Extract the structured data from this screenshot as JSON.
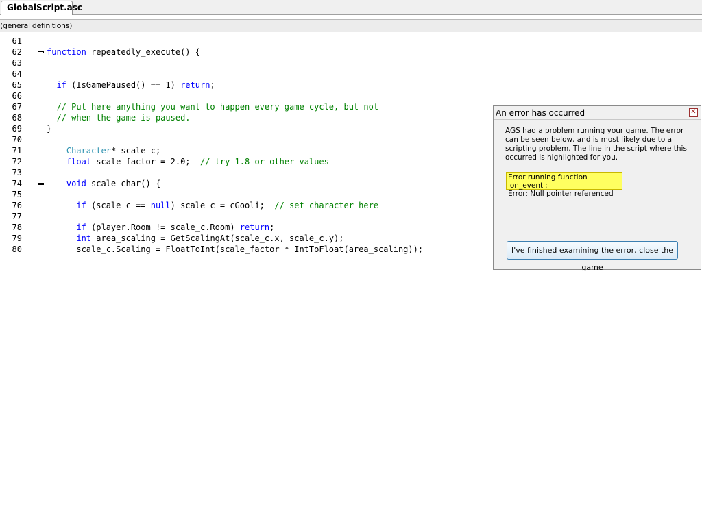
{
  "tab": {
    "label": "GlobalScript.asc"
  },
  "function_selector": {
    "label": "(general definitions)"
  },
  "code": [
    {
      "n": "61",
      "t": []
    },
    {
      "n": "62",
      "fold": true,
      "t": [
        [
          "k",
          "function"
        ],
        [
          "n",
          " repeatedly_execute() {"
        ]
      ]
    },
    {
      "n": "63",
      "t": []
    },
    {
      "n": "64",
      "t": []
    },
    {
      "n": "65",
      "t": [
        [
          "n",
          "  "
        ],
        [
          "k",
          "if"
        ],
        [
          "n",
          " (IsGamePaused() == 1) "
        ],
        [
          "k",
          "return"
        ],
        [
          "n",
          ";"
        ]
      ]
    },
    {
      "n": "66",
      "t": []
    },
    {
      "n": "67",
      "t": [
        [
          "n",
          "  "
        ],
        [
          "c",
          "// Put here anything you want to happen every game cycle, but not"
        ]
      ]
    },
    {
      "n": "68",
      "t": [
        [
          "n",
          "  "
        ],
        [
          "c",
          "// when the game is paused."
        ]
      ]
    },
    {
      "n": "69",
      "t": [
        [
          "n",
          "}"
        ]
      ]
    },
    {
      "n": "70",
      "t": []
    },
    {
      "n": "71",
      "t": [
        [
          "n",
          "    "
        ],
        [
          "t",
          "Character"
        ],
        [
          "n",
          "* scale_c;"
        ]
      ]
    },
    {
      "n": "72",
      "t": [
        [
          "n",
          "    "
        ],
        [
          "k",
          "float"
        ],
        [
          "n",
          " scale_factor = 2.0;  "
        ],
        [
          "c",
          "// try 1.8 or other values"
        ]
      ]
    },
    {
      "n": "73",
      "t": []
    },
    {
      "n": "74",
      "fold": true,
      "t": [
        [
          "n",
          "    "
        ],
        [
          "k",
          "void"
        ],
        [
          "n",
          " scale_char() {"
        ]
      ]
    },
    {
      "n": "75",
      "t": []
    },
    {
      "n": "76",
      "t": [
        [
          "n",
          "      "
        ],
        [
          "k",
          "if"
        ],
        [
          "n",
          " (scale_c == "
        ],
        [
          "k",
          "null"
        ],
        [
          "n",
          ") scale_c = cGooli;  "
        ],
        [
          "c",
          "// set character here"
        ]
      ]
    },
    {
      "n": "77",
      "t": []
    },
    {
      "n": "78",
      "t": [
        [
          "n",
          "      "
        ],
        [
          "k",
          "if"
        ],
        [
          "n",
          " (player.Room != scale_c.Room) "
        ],
        [
          "k",
          "return"
        ],
        [
          "n",
          ";"
        ]
      ]
    },
    {
      "n": "79",
      "t": [
        [
          "n",
          "      "
        ],
        [
          "k",
          "int"
        ],
        [
          "n",
          " area_scaling = GetScalingAt(scale_c.x, scale_c.y);"
        ]
      ]
    },
    {
      "n": "80",
      "t": [
        [
          "n",
          "      scale_c.Scaling = FloatToInt(scale_factor * IntToFloat(area_scaling));"
        ]
      ]
    }
  ],
  "dialog": {
    "title": "An error has occurred",
    "message": "AGS had a problem running your game. The error can be seen below, and is most likely due to a scripting problem. The line in the script where this occurred is highlighted for you.",
    "error_line1": "Error running function 'on_event':",
    "error_line2": "Error: Null pointer referenced",
    "close_button": "I've finished examining the error, close the game"
  }
}
